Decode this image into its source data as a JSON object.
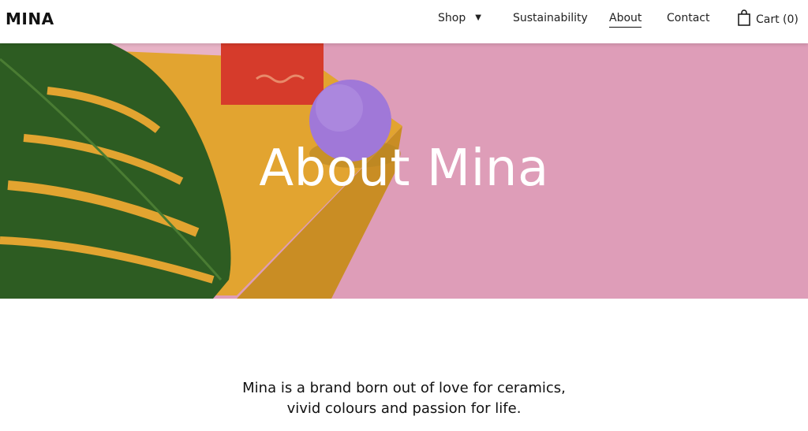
{
  "brand": {
    "name": "MINA"
  },
  "nav": {
    "shop": "Shop",
    "sustainability": "Sustainability",
    "about": "About",
    "contact": "Contact",
    "cart": "Cart (0)",
    "active": "About"
  },
  "icons": {
    "shop_dropdown": "caret-down-icon",
    "cart": "shopping-bag-icon"
  },
  "hero": {
    "title": "About Mina"
  },
  "intro": {
    "line1": "Mina is a brand born out of love for ceramics,",
    "line2": "vivid colours and passion for life."
  },
  "colors": {
    "hero_pink": "#de9db8",
    "box_yellow": "#e2a430",
    "leaf_green": "#2d5c22",
    "red_block": "#d63b2b",
    "ball_purple": "#a078d8"
  }
}
